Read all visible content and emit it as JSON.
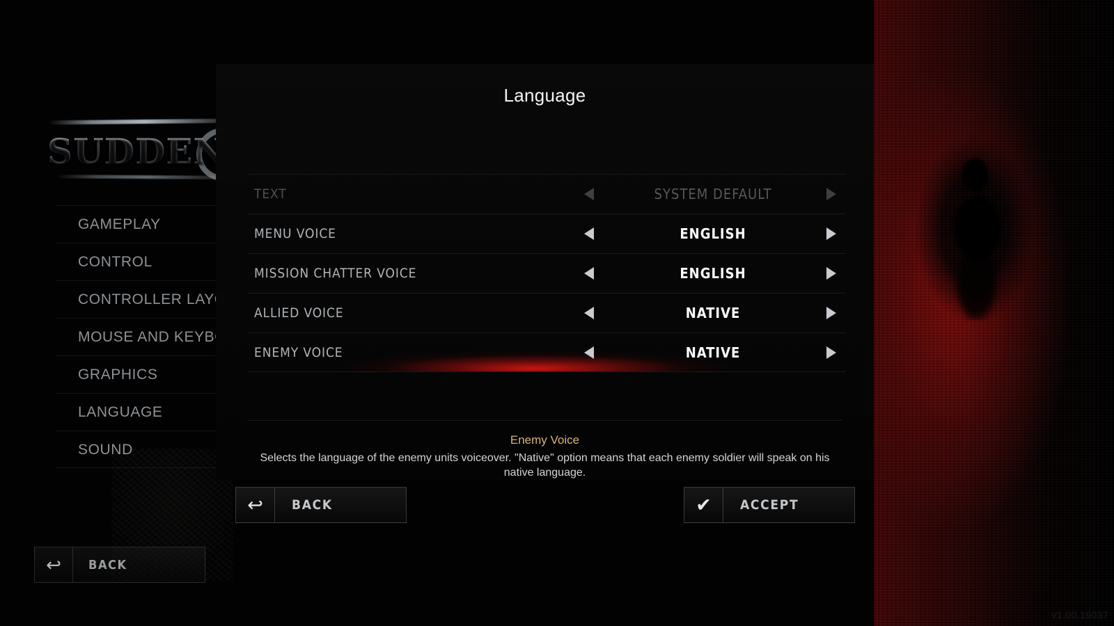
{
  "background": {
    "logo_text": "SUDDEN",
    "version": "v1.00.19037"
  },
  "sidebar": {
    "items": [
      {
        "label": "GAMEPLAY"
      },
      {
        "label": "CONTROL"
      },
      {
        "label": "CONTROLLER LAYOUT"
      },
      {
        "label": "MOUSE AND KEYBOARD"
      },
      {
        "label": "GRAPHICS"
      },
      {
        "label": "LANGUAGE"
      },
      {
        "label": "SOUND"
      }
    ],
    "back_button": {
      "label": "BACK",
      "icon": "back-arrow-icon"
    }
  },
  "modal": {
    "title": "Language",
    "rows": [
      {
        "label": "TEXT",
        "value": "SYSTEM DEFAULT",
        "state": "disabled"
      },
      {
        "label": "MENU VOICE",
        "value": "ENGLISH",
        "state": "normal"
      },
      {
        "label": "MISSION CHATTER VOICE",
        "value": "ENGLISH",
        "state": "normal"
      },
      {
        "label": "ALLIED VOICE",
        "value": "NATIVE",
        "state": "normal"
      },
      {
        "label": "ENEMY VOICE",
        "value": "NATIVE",
        "state": "selected"
      }
    ],
    "description": {
      "title": "Enemy Voice",
      "body": "Selects the language of the enemy units voiceover. \"Native\" option means that each enemy soldier will speak on his native language."
    },
    "buttons": {
      "back": {
        "label": "BACK",
        "icon": "back-arrow-icon"
      },
      "accept": {
        "label": "ACCEPT",
        "icon": "checkmark-icon"
      }
    }
  },
  "colors": {
    "accent_red": "#d61612",
    "desc_title": "#d9b477",
    "text_primary": "#fbfcfc",
    "text_muted": "#8e9296"
  }
}
